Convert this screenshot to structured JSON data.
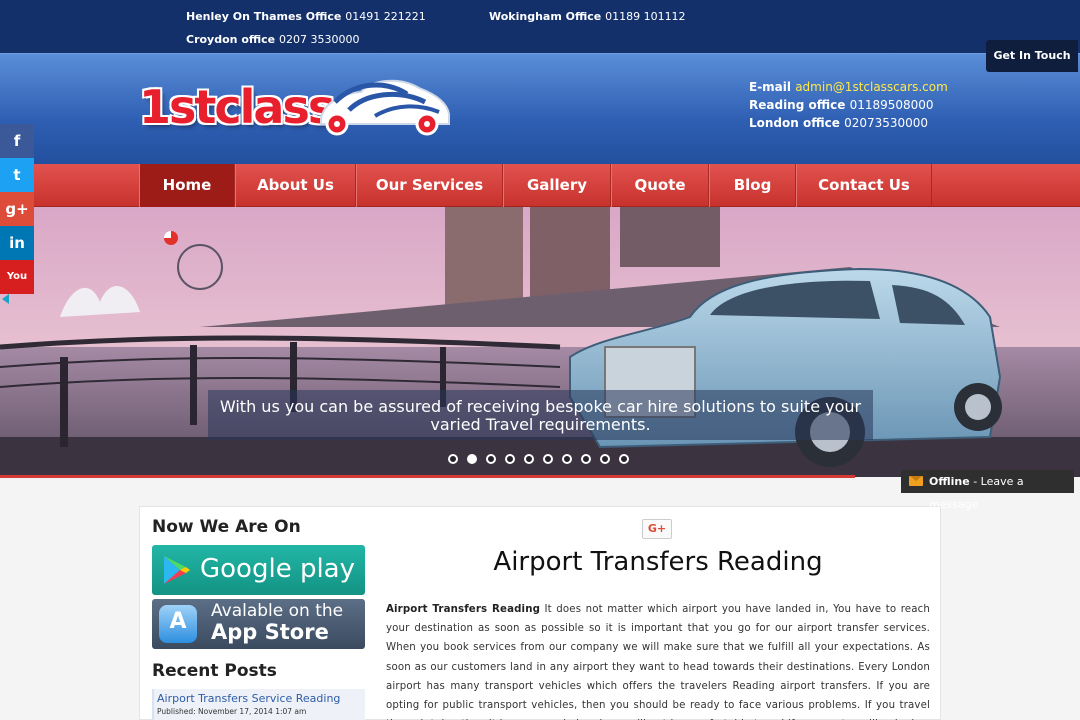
{
  "topbar": {
    "offices": [
      {
        "label": "Henley On Thames Office",
        "number": "01491 221221"
      },
      {
        "label": "Wokingham Office",
        "number": "01189 101112"
      },
      {
        "label": "Croydon office",
        "number": "0207 3530000"
      }
    ],
    "get_in_touch": "Get In Touch"
  },
  "header": {
    "logo_text": "1stclass",
    "email_label": "E-mail",
    "email": "admin@1stclasscars.com",
    "reading_label": "Reading office",
    "reading_number": "01189508000",
    "london_label": "London office",
    "london_number": "02073530000"
  },
  "nav": {
    "items": [
      "Home",
      "About Us",
      "Our Services",
      "Gallery",
      "Quote",
      "Blog",
      "Contact Us"
    ],
    "active": "Home"
  },
  "social": {
    "items": [
      {
        "name": "facebook",
        "glyph": "f",
        "color": "#3b5998"
      },
      {
        "name": "twitter",
        "glyph": "t",
        "color": "#1da1f2"
      },
      {
        "name": "google-plus",
        "glyph": "g+",
        "color": "#dd4b39"
      },
      {
        "name": "linkedin",
        "glyph": "in",
        "color": "#0077b5"
      },
      {
        "name": "youtube",
        "glyph": "You",
        "color": "#d71f1f"
      }
    ]
  },
  "slider": {
    "caption_line1": "With us you can be assured of receiving bespoke car hire solutions to suite your",
    "caption_line2": "varied Travel requirements.",
    "slide_count": 10,
    "active_slide": 2
  },
  "chat": {
    "status": "Offline",
    "message": " - Leave a message"
  },
  "sidebar": {
    "now_we_are_on": "Now We Are On",
    "google_play": "Google play",
    "app_store_line1": "Avalable on the",
    "app_store_line2": "App Store",
    "recent_posts": "Recent Posts",
    "post_title": "Airport Transfers Service Reading",
    "post_date": "Published: November 17, 2014 1:07 am"
  },
  "main": {
    "gplus": "G+",
    "title": "Airport Transfers Reading",
    "lead": "Airport Transfers Reading",
    "body": " It does not matter which airport you have landed in, You have to reach your destination as soon as possible so it is important that you go for our airport transfer services. When you book services from our company we will make sure that we fulfill all your expectations. As soon as our customers land in any airport they want to head towards their destinations. Every London airport has many transport vehicles which offers the travelers Reading airport transfers. If you are opting for public transport vehicles, then you should be ready to face various problems. If you travel through tube, then it is overcrowded and you will not be comfortable travel if you are travelling by bus you will find it hard to find a suitable place to sit and"
  }
}
